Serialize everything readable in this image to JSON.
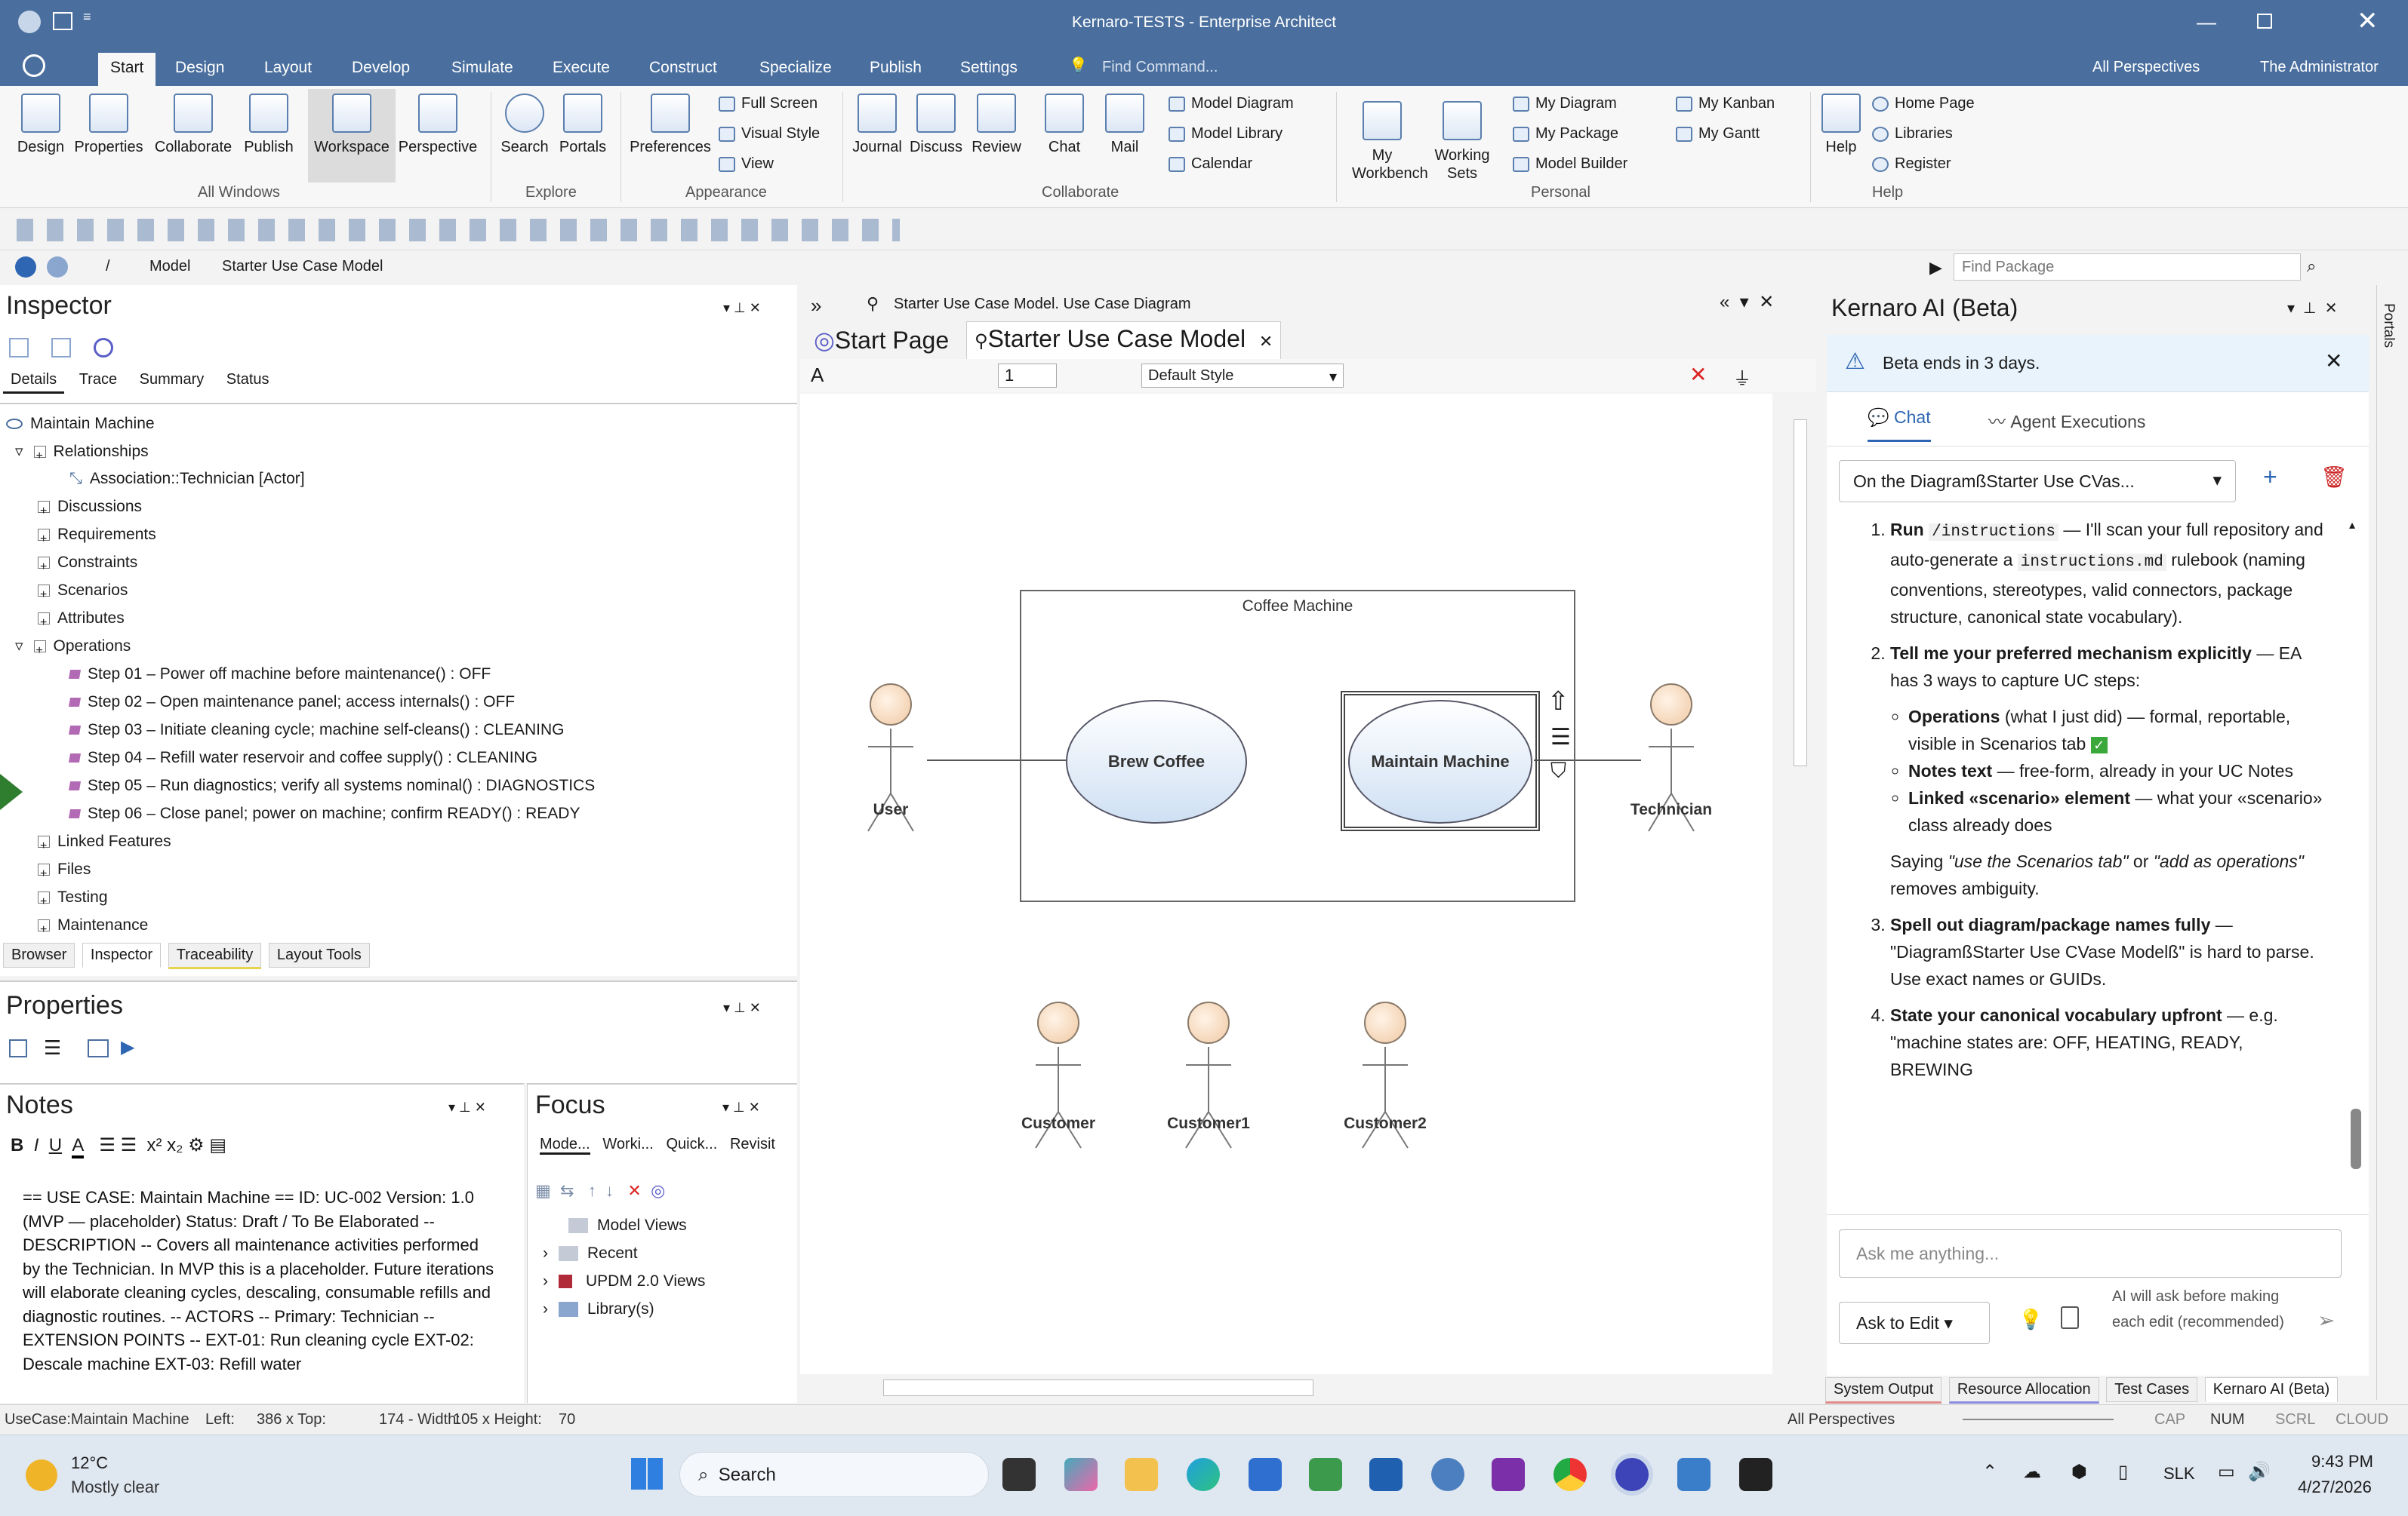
{
  "window": {
    "title": "Kernaro-TESTS - Enterprise Architect",
    "perspectives": "All Perspectives",
    "user": "The Administrator"
  },
  "menu": {
    "tabs": [
      "Start",
      "Design",
      "Layout",
      "Develop",
      "Simulate",
      "Execute",
      "Construct",
      "Specialize",
      "Publish",
      "Settings"
    ],
    "find_command": "Find Command..."
  },
  "ribbon": {
    "all_windows": [
      "Design",
      "Properties",
      "Collaborate",
      "Publish",
      "Workspace",
      "Perspective"
    ],
    "explore": [
      "Search",
      "Portals"
    ],
    "appearance": {
      "big": "Preferences",
      "small": [
        "Full Screen",
        "Visual Style",
        "View"
      ]
    },
    "collaborate": [
      "Journal",
      "Discuss",
      "Review",
      "Chat",
      "Mail"
    ],
    "collab_small": [
      "Model Diagram",
      "Model Library",
      "Calendar"
    ],
    "personal_big": [
      "My Workbench",
      "Working Sets"
    ],
    "personal_small": [
      "My Diagram",
      "My Package",
      "Model Builder",
      "My Kanban",
      "My Gantt"
    ],
    "help_big": "Help",
    "help_small": [
      "Home Page",
      "Libraries",
      "Register"
    ],
    "groups": [
      "All Windows",
      "Explore",
      "Appearance",
      "Collaborate",
      "Personal",
      "Help"
    ]
  },
  "addressbar": {
    "path": [
      "/",
      "Model",
      "Starter Use Case Model"
    ],
    "find_package": "Find Package"
  },
  "inspector": {
    "title": "Inspector",
    "tabs": [
      "Details",
      "Trace",
      "Summary",
      "Status"
    ],
    "root": "Maintain Machine",
    "relationships": "Relationships",
    "association": "Association::Technician [Actor]",
    "nodes": [
      "Discussions",
      "Requirements",
      "Constraints",
      "Scenarios",
      "Attributes"
    ],
    "operations_label": "Operations",
    "operations": [
      "Step 01 – Power off machine before maintenance() : OFF",
      "Step 02 – Open maintenance panel; access internals() : OFF",
      "Step 03 – Initiate cleaning cycle; machine self-cleans() : CLEANING",
      "Step 04 – Refill water reservoir and coffee supply() : CLEANING",
      "Step 05 – Run diagnostics; verify all systems nominal() : DIAGNOSTICS",
      "Step 06 – Close panel; power on machine; confirm READY() : READY"
    ],
    "after": [
      "Linked Features",
      "Files",
      "Testing",
      "Maintenance"
    ],
    "bottom_tabs": [
      "Browser",
      "Inspector",
      "Traceability",
      "Layout Tools"
    ]
  },
  "properties": {
    "title": "Properties"
  },
  "notes": {
    "title": "Notes",
    "text": "== USE CASE: Maintain Machine == ID: UC-002 Version: 1.0 (MVP — placeholder) Status: Draft / To Be Elaborated -- DESCRIPTION -- Covers all maintenance activities performed by the Technician. In MVP this is a placeholder. Future iterations will elaborate cleaning cycles, descaling, consumable refills and diagnostic routines. -- ACTORS -- Primary: Technician -- EXTENSION POINTS -- EXT-01: Run cleaning cycle EXT-02: Descale machine EXT-03: Refill water"
  },
  "focus": {
    "title": "Focus",
    "tabs": [
      "Mode...",
      "Worki...",
      "Quick...",
      "Revisit"
    ],
    "items": [
      "Model Views",
      "Recent",
      "UPDM 2.0 Views",
      "Library(s)"
    ]
  },
  "diagram": {
    "header": "Starter Use Case Model.  Use Case Diagram",
    "tabs": [
      "Start Page",
      "Starter Use Case Model"
    ],
    "zoom": "1",
    "style": "Default Style",
    "boundary": "Coffee Machine",
    "usecases": [
      "Brew Coffee",
      "Maintain Machine"
    ],
    "actors": [
      "User",
      "Technician",
      "Customer",
      "Customer1",
      "Customer2"
    ]
  },
  "ai": {
    "title": "Kernaro AI (Beta)",
    "beta": "Beta ends in 3 days.",
    "tabs": [
      "Chat",
      "Agent Executions"
    ],
    "conversation": "On the DiagramßStarter Use CVas...",
    "i1_bold": "Run",
    "i1_code": "/instructions",
    "i1_rest": "— I'll scan your full repository and auto-generate a",
    "i1_code2": "instructions.md",
    "i1_rest2": "rulebook (naming conventions, stereotypes, valid connectors, package structure, canonical state vocabulary).",
    "i2_bold": "Tell me your preferred mechanism explicitly",
    "i2_rest": "— EA has 3 ways to capture UC steps:",
    "b1_bold": "Operations",
    "b1_rest": "(what I just did) — formal, reportable, visible in Scenarios tab",
    "b2_bold": "Notes text",
    "b2_rest": "— free-form, already in your UC Notes",
    "b3_bold": "Linked «scenario» element",
    "b3_rest": "— what your «scenario» class already does",
    "saying1": "Saying",
    "saying_q1": "\"use the Scenarios tab\"",
    "saying2": "or",
    "saying_q2": "\"add as operations\"",
    "saying3": "removes ambiguity.",
    "i3_bold": "Spell out diagram/package names fully",
    "i3_rest": "— \"DiagramßStarter Use CVase Modelß\" is hard to parse. Use exact names or GUIDs.",
    "i4_bold": "State your canonical vocabulary upfront",
    "i4_rest": "— e.g. \"machine states are: OFF, HEATING, READY, BREWING",
    "input_placeholder": "Ask me anything...",
    "mode": "Ask to Edit",
    "mode_note": "AI will ask before making each edit (recommended)",
    "bottom_tabs": [
      "System Output",
      "Resource Allocation",
      "Test Cases",
      "Kernaro AI (Beta)"
    ],
    "portals": "Portals"
  },
  "status": {
    "element": "UseCase:Maintain Machine",
    "left": "Left:",
    "left_v": "386 x Top:",
    "top_v": "174 - Width:",
    "width_v": "105 x Height:",
    "height_v": "70",
    "perspectives": "All Perspectives",
    "keys": [
      "CAP",
      "NUM",
      "SCRL",
      "CLOUD"
    ]
  },
  "taskbar": {
    "temp": "12°C",
    "weather": "Mostly clear",
    "search": "Search",
    "lang": "SLK",
    "time": "9:43 PM",
    "date": "4/27/2026"
  }
}
